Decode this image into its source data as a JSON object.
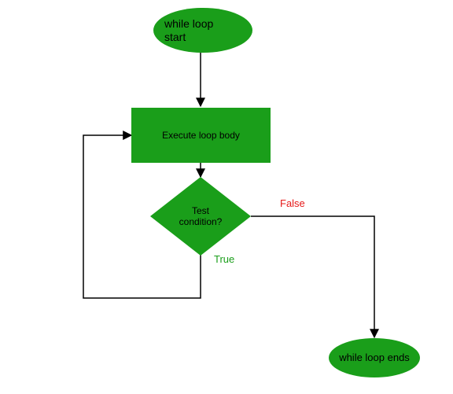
{
  "chart_data": {
    "type": "flowchart",
    "nodes": [
      {
        "id": "start",
        "shape": "ellipse",
        "label": "while loop start"
      },
      {
        "id": "body",
        "shape": "rectangle",
        "label": "Execute loop body"
      },
      {
        "id": "cond",
        "shape": "diamond",
        "label": "Test condition?"
      },
      {
        "id": "end",
        "shape": "ellipse",
        "label": "while loop ends"
      }
    ],
    "edges": [
      {
        "from": "start",
        "to": "body",
        "label": ""
      },
      {
        "from": "body",
        "to": "cond",
        "label": ""
      },
      {
        "from": "cond",
        "to": "body",
        "label": "True",
        "label_color": "#1a9e1a"
      },
      {
        "from": "cond",
        "to": "end",
        "label": "False",
        "label_color": "#e61919"
      }
    ]
  },
  "nodes": {
    "start": "while loop\nstart",
    "body": "Execute loop body",
    "cond": "Test\ncondition?",
    "end": "while loop ends"
  },
  "labels": {
    "true": "True",
    "false": "False"
  },
  "colors": {
    "fill": "#1a9e1a",
    "true": "#1a9e1a",
    "false": "#e61919",
    "edge": "#000000"
  }
}
